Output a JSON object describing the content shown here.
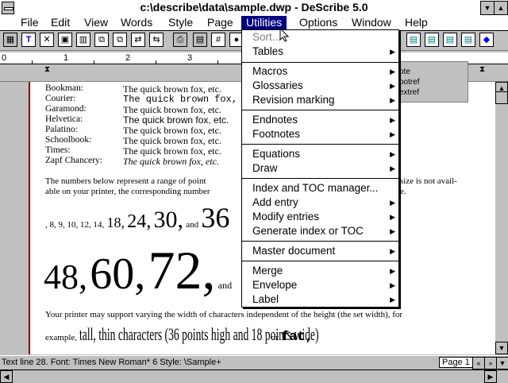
{
  "window": {
    "title": "c:\\describe\\data\\sample.dwp - DeScribe 5.0"
  },
  "menubar": {
    "items": [
      "File",
      "Edit",
      "View",
      "Words",
      "Style",
      "Page",
      "Utilities",
      "Options",
      "Window",
      "Help"
    ]
  },
  "ruler": {
    "numbers": [
      "0",
      "1",
      "2",
      "3"
    ]
  },
  "document": {
    "fonts": [
      {
        "name": "Bookman:",
        "sample": "The quick brown fox, etc."
      },
      {
        "name": "Courier:",
        "sample": "The quick brown fox, etc."
      },
      {
        "name": "Garamond:",
        "sample": "The quick brown fox, etc."
      },
      {
        "name": "Helvetica:",
        "sample": "The quick brown fox, etc."
      },
      {
        "name": "Palatino:",
        "sample": "The quick brown fox, etc."
      },
      {
        "name": "Schoolbook:",
        "sample": "The quick brown fox, etc."
      },
      {
        "name": "Times:",
        "sample": "The quick brown fox, etc."
      },
      {
        "name": "Zapf Chancery:",
        "sample": "The quick brown fox, etc."
      }
    ],
    "para1_line1": "The numbers below represent a range of point",
    "para1_line1_right": "size is not avail-",
    "para1_line2": "able on your printer, the corresponding number",
    "para1_line2_right": "e.",
    "sizes_small": ", 8, 9, 10, 12, 14,",
    "size_18": "18,",
    "size_24": "24,",
    "size_30": "30,",
    "and1": "and",
    "size_36": "36",
    "size_48": "48,",
    "size_60": "60,",
    "size_72": "72,",
    "and2": "and",
    "para2_line1": "Your printer may support varying the width of characters independent of the height (the set width), for",
    "para2_example": "example,",
    "para2_tall": "tall, thin characters (36 points high and 18 points wide)",
    "para2_or": "or",
    "para2_fat": "fat,"
  },
  "side_panel": {
    "lines": [
      "ote",
      "ootref",
      "extref"
    ]
  },
  "dropdown": {
    "items": [
      {
        "label": "Sort...",
        "disabled": true,
        "sub": false
      },
      {
        "label": "Tables",
        "sub": true
      },
      {
        "label": "Macros",
        "sub": true
      },
      {
        "label": "Glossaries",
        "sub": true
      },
      {
        "label": "Revision marking",
        "sub": true
      },
      {
        "label": "Endnotes",
        "sub": true
      },
      {
        "label": "Footnotes",
        "sub": true
      },
      {
        "label": "Equations",
        "sub": true
      },
      {
        "label": "Draw",
        "sub": true
      },
      {
        "label": "Index and TOC manager...",
        "sub": false
      },
      {
        "label": "Add entry",
        "sub": true
      },
      {
        "label": "Modify entries",
        "sub": true
      },
      {
        "label": "Generate index or TOC",
        "sub": true
      },
      {
        "label": "Master document",
        "sub": true
      },
      {
        "label": "Merge",
        "sub": true
      },
      {
        "label": "Envelope",
        "sub": true
      },
      {
        "label": "Label",
        "sub": true
      }
    ]
  },
  "status": {
    "text": "Text line 28.  Font: Times New Roman* 6  Style: \\Sample+",
    "page": "Page 1"
  }
}
